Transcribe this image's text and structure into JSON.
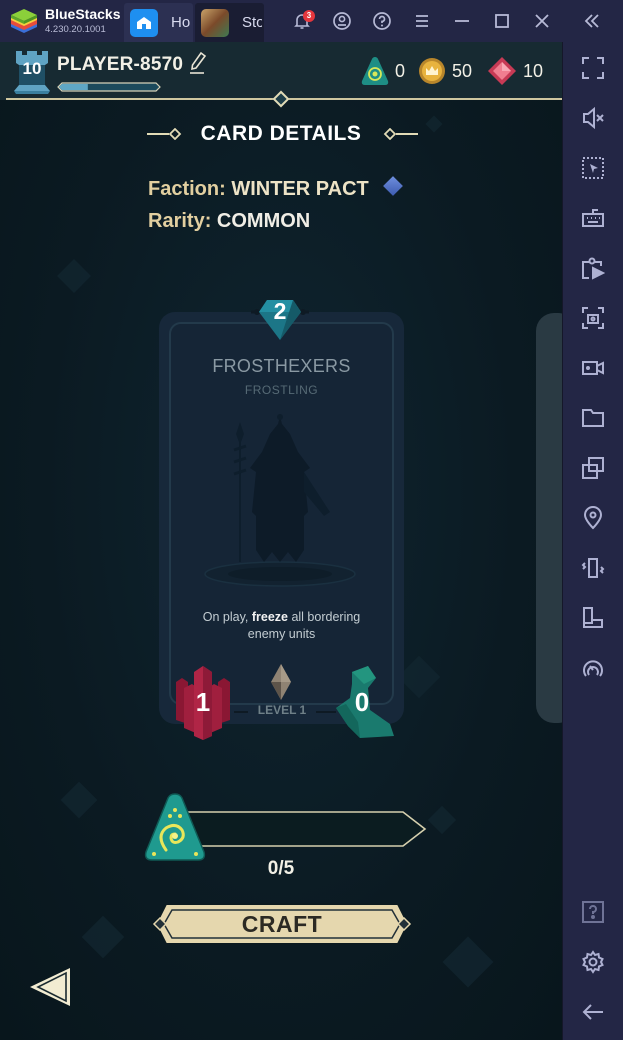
{
  "window": {
    "app_name": "BlueStacks",
    "version": "4.230.20.1001",
    "tabs": [
      {
        "label": "Home",
        "icon": "home-icon"
      },
      {
        "label": "Stormbound",
        "icon": "game-thumbnail"
      }
    ],
    "notification_count": "3",
    "controls": [
      "bell-icon",
      "account-icon",
      "help-icon",
      "menu-icon",
      "minimize-icon",
      "maximize-icon",
      "close-icon",
      "collapse-sidebar-icon"
    ]
  },
  "sidebar": {
    "items": [
      {
        "name": "fullscreen",
        "icon": "fullscreen-icon"
      },
      {
        "name": "volume",
        "icon": "mute-icon"
      },
      {
        "name": "pointer",
        "icon": "cursor-select-icon"
      },
      {
        "name": "keyboard",
        "icon": "keyboard-icon"
      },
      {
        "name": "install-apk",
        "icon": "apk-install-icon"
      },
      {
        "name": "screenshot",
        "icon": "screenshot-icon"
      },
      {
        "name": "record",
        "icon": "video-record-icon"
      },
      {
        "name": "media-folder",
        "icon": "folder-icon"
      },
      {
        "name": "multi-instance",
        "icon": "multi-instance-icon"
      },
      {
        "name": "location",
        "icon": "location-icon"
      },
      {
        "name": "shake",
        "icon": "shake-icon"
      },
      {
        "name": "rotate",
        "icon": "rotate-icon"
      },
      {
        "name": "eco-mode",
        "icon": "speedometer-icon"
      },
      {
        "name": "help",
        "icon": "help-box-icon"
      },
      {
        "name": "settings",
        "icon": "gear-icon"
      },
      {
        "name": "back",
        "icon": "arrow-left-icon"
      }
    ]
  },
  "player": {
    "level": "10",
    "name": "PLAYER-8570",
    "xp_progress": 0.3
  },
  "currencies": [
    {
      "name": "fragments",
      "icon": "rune-icon",
      "value": "0"
    },
    {
      "name": "coins",
      "icon": "crown-coin-icon",
      "value": "50"
    },
    {
      "name": "rubies",
      "icon": "ruby-icon",
      "value": "10"
    }
  ],
  "page": {
    "title": "CARD DETAILS",
    "faction_label": "Faction:",
    "faction_value": "WINTER PACT",
    "rarity_label": "Rarity:",
    "rarity_value": "COMMON"
  },
  "card": {
    "cost": "2",
    "name": "FROSTHEXERS",
    "type": "FROSTLING",
    "text_before": "On play, ",
    "text_bold": "freeze",
    "text_after": " all bordering enemy units",
    "strength": "1",
    "movement": "0",
    "level": "LEVEL 1"
  },
  "progress": {
    "current": 0,
    "required": 5,
    "label": "0/5"
  },
  "actions": {
    "craft_label": "CRAFT"
  },
  "colors": {
    "accent_cream": "#e8dcb4",
    "teal": "#1f8a8a",
    "strength_red": "#a3203f",
    "sidebar_bg": "#232645"
  }
}
